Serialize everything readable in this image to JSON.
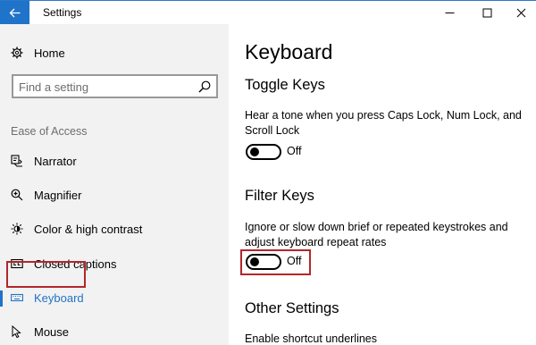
{
  "window": {
    "title": "Settings",
    "accent_color": "#1f73c8",
    "highlight_color": "#b3262a"
  },
  "titlebar": {
    "back_icon": "arrow-left-icon",
    "minimize_icon": "minimize-icon",
    "maximize_icon": "maximize-icon",
    "close_icon": "close-icon"
  },
  "sidebar": {
    "home_label": "Home",
    "home_icon": "gear-icon",
    "search_placeholder": "Find a setting",
    "search_icon": "search-icon",
    "section_label": "Ease of Access",
    "items": [
      {
        "label": "Narrator",
        "icon": "narrator-icon",
        "selected": false
      },
      {
        "label": "Magnifier",
        "icon": "magnifier-icon",
        "selected": false
      },
      {
        "label": "Color & high contrast",
        "icon": "brightness-icon",
        "selected": false
      },
      {
        "label": "Closed captions",
        "icon": "closed-captions-icon",
        "selected": false
      },
      {
        "label": "Keyboard",
        "icon": "keyboard-icon",
        "selected": true
      },
      {
        "label": "Mouse",
        "icon": "mouse-icon",
        "selected": false
      }
    ]
  },
  "main": {
    "title": "Keyboard",
    "toggle_keys": {
      "heading": "Toggle Keys",
      "description": "Hear a tone when you press Caps Lock, Num Lock, and Scroll Lock",
      "state": "Off"
    },
    "filter_keys": {
      "heading": "Filter Keys",
      "description": "Ignore or slow down brief or repeated keystrokes and adjust keyboard repeat rates",
      "state": "Off"
    },
    "other_settings": {
      "heading": "Other Settings",
      "description": "Enable shortcut underlines"
    }
  }
}
